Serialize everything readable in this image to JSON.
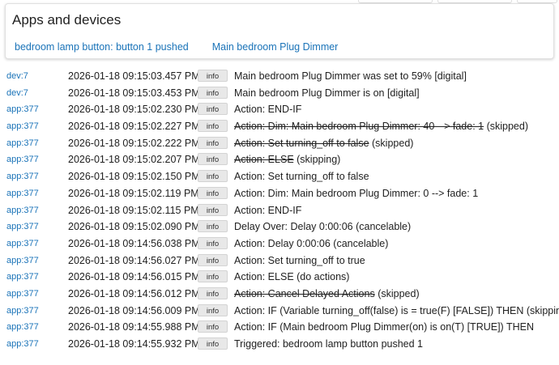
{
  "apps_panel": {
    "title": "Apps and devices",
    "links": [
      "bedroom lamp button: button 1 pushed",
      "Main bedroom Plug Dimmer"
    ]
  },
  "info_label": "info",
  "log": [
    {
      "source": "dev:7",
      "time": "2026-01-18 09:15:03.457 PM",
      "msg": "Main bedroom Plug Dimmer was set to 59% [digital]"
    },
    {
      "source": "dev:7",
      "time": "2026-01-18 09:15:03.453 PM",
      "msg": "Main bedroom Plug Dimmer is on [digital]"
    },
    {
      "source": "app:377",
      "time": "2026-01-18 09:15:02.230 PM",
      "msg": "Action: END-IF"
    },
    {
      "source": "app:377",
      "time": "2026-01-18 09:15:02.227 PM",
      "struck": "Action: Dim: Main bedroom Plug Dimmer: 40 --> fade: 1",
      "suffix": " (skipped)"
    },
    {
      "source": "app:377",
      "time": "2026-01-18 09:15:02.222 PM",
      "struck": "Action: Set turning_off to false",
      "suffix": " (skipped)"
    },
    {
      "source": "app:377",
      "time": "2026-01-18 09:15:02.207 PM",
      "struck": "Action: ELSE",
      "suffix": " (skipping)"
    },
    {
      "source": "app:377",
      "time": "2026-01-18 09:15:02.150 PM",
      "msg": "Action: Set turning_off to false"
    },
    {
      "source": "app:377",
      "time": "2026-01-18 09:15:02.119 PM",
      "msg": "Action: Dim: Main bedroom Plug Dimmer: 0 --> fade: 1"
    },
    {
      "source": "app:377",
      "time": "2026-01-18 09:15:02.115 PM",
      "msg": "Action: END-IF"
    },
    {
      "source": "app:377",
      "time": "2026-01-18 09:15:02.090 PM",
      "msg": "Delay Over: Delay 0:00:06 (cancelable)"
    },
    {
      "source": "app:377",
      "time": "2026-01-18 09:14:56.038 PM",
      "msg": "Action: Delay 0:00:06 (cancelable)"
    },
    {
      "source": "app:377",
      "time": "2026-01-18 09:14:56.027 PM",
      "msg": "Action: Set turning_off to true"
    },
    {
      "source": "app:377",
      "time": "2026-01-18 09:14:56.015 PM",
      "msg": "Action: ELSE (do actions)"
    },
    {
      "source": "app:377",
      "time": "2026-01-18 09:14:56.012 PM",
      "struck": "Action: Cancel Delayed Actions",
      "suffix": " (skipped)"
    },
    {
      "source": "app:377",
      "time": "2026-01-18 09:14:56.009 PM",
      "msg": "Action: IF (Variable turning_off(false) is = true(F) [FALSE]) THEN (skipping)"
    },
    {
      "source": "app:377",
      "time": "2026-01-18 09:14:55.988 PM",
      "msg": "Action: IF (Main bedroom Plug Dimmer(on) is on(T) [TRUE]) THEN"
    },
    {
      "source": "app:377",
      "time": "2026-01-18 09:14:55.932 PM",
      "msg": "Triggered: bedroom lamp button pushed 1"
    }
  ]
}
